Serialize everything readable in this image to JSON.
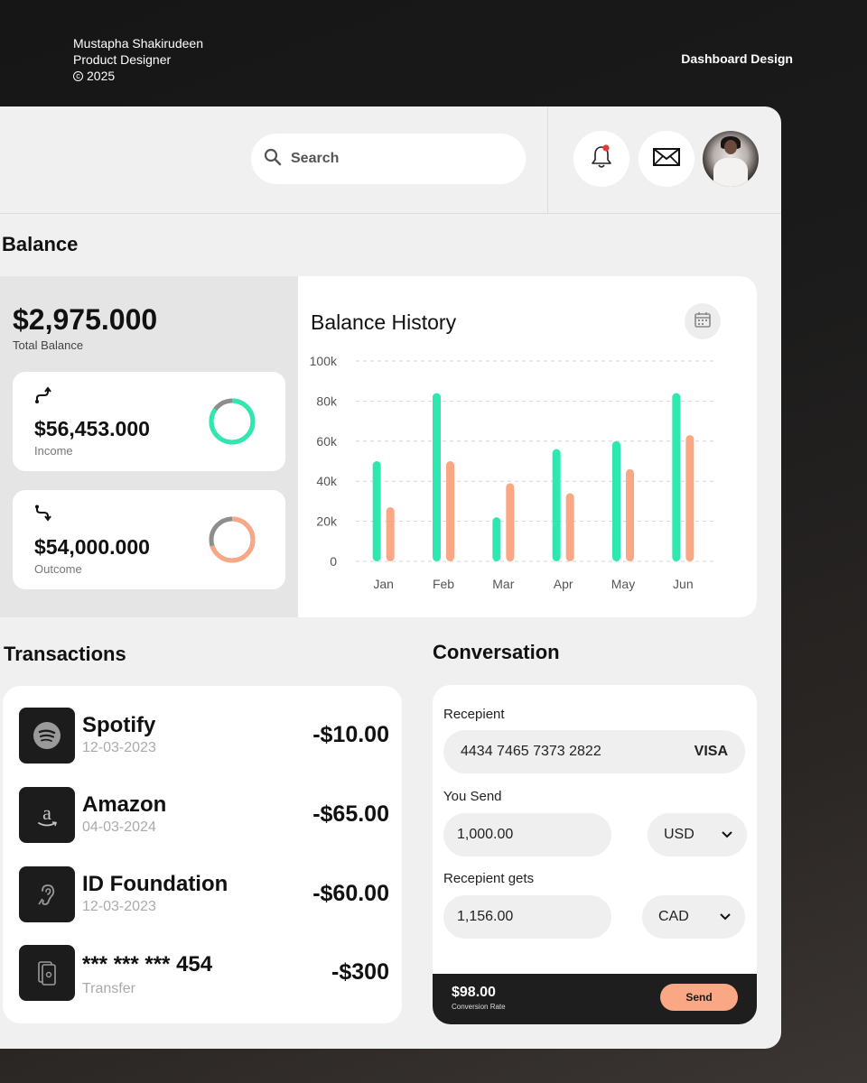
{
  "credit": {
    "name": "Mustapha Shakirudeen",
    "role": "Product Designer",
    "year": "2025",
    "copyright_symbol": "c"
  },
  "project_label": "Dashboard Design",
  "header": {
    "search_placeholder": "Search",
    "notification_badge_color": "#e53935"
  },
  "balance": {
    "title": "Balance",
    "total_amount": "$2,975.000",
    "total_label": "Total Balance",
    "income": {
      "amount": "$56,453.000",
      "label": "Income",
      "ring_color": "#2ee8b0",
      "ring_fraction": 0.85
    },
    "outcome": {
      "amount": "$54,000.000",
      "label": "Outcome",
      "ring_color": "#f9a784",
      "ring_fraction": 0.7
    }
  },
  "chart_data": {
    "type": "bar",
    "title": "Balance History",
    "categories": [
      "Jan",
      "Feb",
      "Mar",
      "Apr",
      "May",
      "Jun"
    ],
    "series": [
      {
        "color": "#2ee8b0",
        "values": [
          50,
          84,
          22,
          56,
          60,
          84
        ]
      },
      {
        "color": "#f9a784",
        "values": [
          27,
          50,
          39,
          34,
          46,
          63
        ]
      }
    ],
    "y_ticks": [
      "0",
      "20k",
      "40k",
      "60k",
      "80k",
      "100k"
    ],
    "ylim": [
      0,
      100
    ],
    "grid": true
  },
  "transactions": {
    "title": "Transactions",
    "items": [
      {
        "name": "Spotify",
        "sub": "12-03-2023",
        "amount": "-$10.00",
        "icon": "spotify-icon"
      },
      {
        "name": "Amazon",
        "sub": "04-03-2024",
        "amount": "-$65.00",
        "icon": "amazon-icon"
      },
      {
        "name": "ID Foundation",
        "sub": "12-03-2023",
        "amount": "-$60.00",
        "icon": "hearing-icon"
      },
      {
        "name": "*** *** *** 454",
        "sub": "Transfer",
        "amount": "-$300",
        "icon": "transfer-icon"
      }
    ]
  },
  "conversation": {
    "title": "Conversation",
    "recipient_label": "Recepient",
    "card_number": "4434 7465 7373 2822",
    "card_brand": "VISA",
    "send_label": "You Send",
    "send_amount": "1,000.00",
    "send_currency": "USD",
    "gets_label": "Recepient gets",
    "gets_amount": "1,156.00",
    "gets_currency": "CAD",
    "rate_value": "$98.00",
    "rate_label": "Conversion Rate",
    "send_button": "Send"
  }
}
